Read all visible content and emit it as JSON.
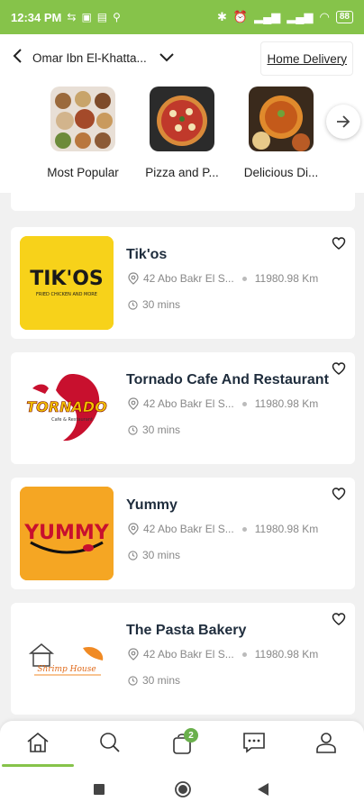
{
  "status_bar": {
    "time": "12:34 PM",
    "battery": "88"
  },
  "header": {
    "address": "Omar Ibn El-Khatta...",
    "delivery_mode": "Home Delivery"
  },
  "categories": [
    {
      "label": "Most Popular"
    },
    {
      "label": "Pizza and P..."
    },
    {
      "label": "Delicious Di..."
    }
  ],
  "restaurants": [
    {
      "name": "Tik'os",
      "address": "42 Abo Bakr El S...",
      "distance": "11980.98 Km",
      "time": "30 mins",
      "logo_text": "TIK'OS",
      "logo_sub": "FRIED CHICKEN AND MORE",
      "logo_bg": "#f7d21a"
    },
    {
      "name": "Tornado Cafe And Restaurant",
      "address": "42 Abo Bakr El S...",
      "distance": "11980.98 Km",
      "time": "30 mins",
      "logo_text": "TORNADO",
      "logo_sub": "Cafe & Restaurant",
      "logo_bg": "#ffffff"
    },
    {
      "name": "Yummy",
      "address": "42 Abo Bakr El S...",
      "distance": "11980.98 Km",
      "time": "30 mins",
      "logo_text": "YUMMY",
      "logo_bg": "#f5a623"
    },
    {
      "name": "The Pasta Bakery",
      "address": "42 Abo Bakr El S...",
      "distance": "11980.98 Km",
      "time": "30 mins",
      "logo_text": "Shrimp House",
      "logo_bg": "#ffffff"
    }
  ],
  "bottom_nav": {
    "items": [
      {
        "icon": "home-icon"
      },
      {
        "icon": "search-icon"
      },
      {
        "icon": "cart-icon",
        "badge": "2"
      },
      {
        "icon": "chat-icon"
      },
      {
        "icon": "profile-icon"
      }
    ]
  },
  "colors": {
    "brand_green": "#86c34a",
    "badge_green": "#6ab04c"
  }
}
